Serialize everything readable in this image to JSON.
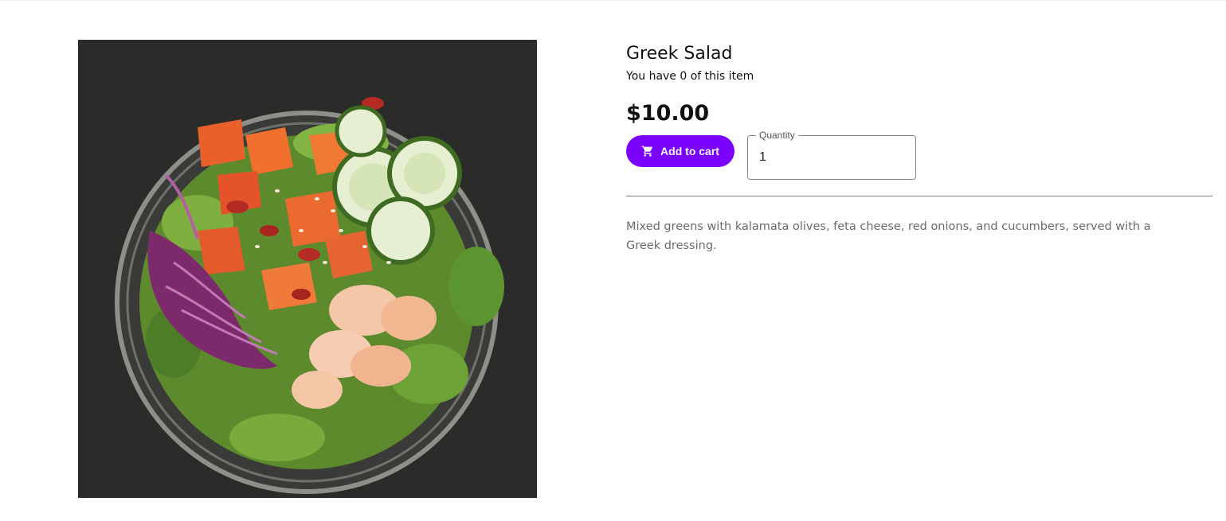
{
  "product": {
    "title": "Greek Salad",
    "owned_text": "You have 0 of this item",
    "price": "$10.00",
    "description": "Mixed greens with kalamata olives, feta cheese, red onions, and cucumbers, served with a Greek dressing.",
    "image_subject": "salad bowl photo"
  },
  "actions": {
    "add_to_cart_label": "Add to cart",
    "cart_icon": "shopping-cart-icon",
    "quantity_label": "Quantity",
    "quantity_value": "1"
  },
  "colors": {
    "accent": "#7a00ff",
    "background": "#ffffff",
    "photo_background": "#2b2b2a"
  }
}
